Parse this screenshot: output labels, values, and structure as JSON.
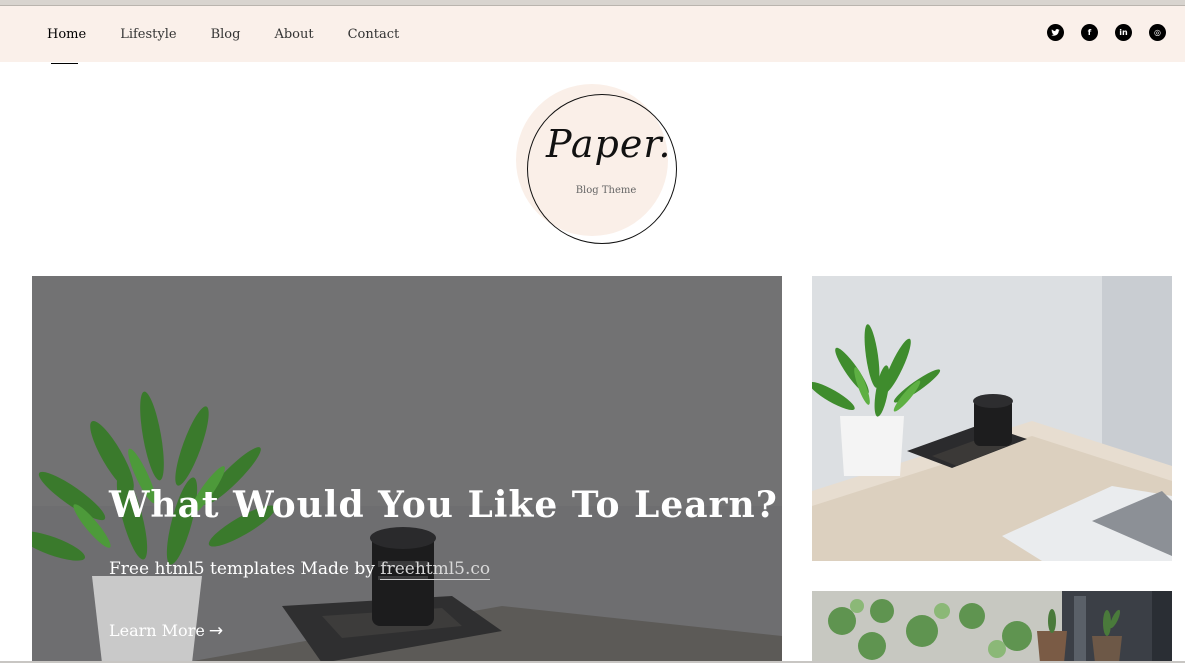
{
  "nav": {
    "items": [
      {
        "label": "Home",
        "active": true
      },
      {
        "label": "Lifestyle",
        "active": false
      },
      {
        "label": "Blog",
        "active": false
      },
      {
        "label": "About",
        "active": false
      },
      {
        "label": "Contact",
        "active": false
      }
    ]
  },
  "social": [
    {
      "icon": "twitter-icon",
      "glyph": "t"
    },
    {
      "icon": "facebook-icon",
      "glyph": "f"
    },
    {
      "icon": "linkedin-icon",
      "glyph": "in"
    },
    {
      "icon": "dribbble-icon",
      "glyph": "◎"
    }
  ],
  "logo": {
    "title": "Paper.",
    "subtitle": "Blog Theme"
  },
  "hero": {
    "title": "What Would You Like To Learn?",
    "subtitle_prefix": "Free html5 templates Made by ",
    "subtitle_link": "freehtml5.co",
    "cta": "Learn More",
    "cta_arrow": "→"
  },
  "colors": {
    "navbar_bg": "#faf0ea",
    "logo_blob": "#faefe8",
    "hero_overlay": "#6b6b6d",
    "text_dark": "#000000"
  }
}
